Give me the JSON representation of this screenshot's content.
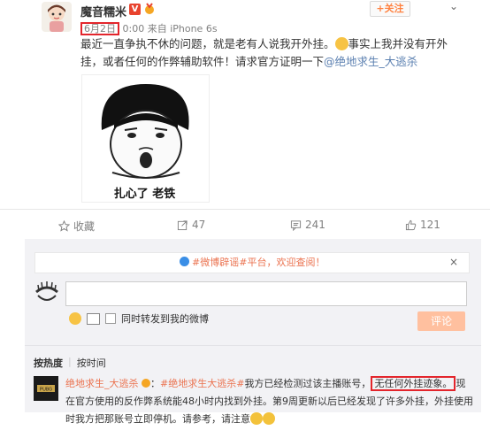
{
  "post": {
    "username": "魔音糯米",
    "vip_badge": "V",
    "follow_label": "+关注",
    "date": "6月2日",
    "time_source": "0:00 来自 iPhone 6s",
    "content_part1": "最近一直争执不休的问题，就是老有人说我开外挂。",
    "content_part2": "事实上我并没有开外挂，或者任何的作弊辅助软件！请求官方证明一下",
    "mention": "@绝地求生_大逃杀",
    "image_caption": "扎心了 老铁"
  },
  "actions": {
    "favorite_label": "收藏",
    "repost_count": "47",
    "comment_count": "241",
    "like_count": "121"
  },
  "comment_panel": {
    "notice_hashtag": "#微博辟谣#平台，欢迎查阅！",
    "close_icon": "×",
    "sync_label": "同时转发到我的微博",
    "comment_button": "评论",
    "sort_hot": "按热度",
    "sort_time": "按时间"
  },
  "top_comment": {
    "author": "绝地求生_大逃杀",
    "hashtag": "#绝地求生大逃杀#",
    "text1": "我方已经检测过该主播账号，",
    "highlight": "无任何外挂迹象。",
    "text2": "现在官方使用的反作弊系统能48小时内找到外挂。第9周更新以后已经发现了许多外挂，外挂使用时我方把那账号立即停机。请参考，请注意"
  },
  "colors": {
    "accent": "#eb7350",
    "highlight_border": "#e3252c",
    "vip_red": "#e8432e",
    "button_disabled": "#ffc09f"
  }
}
